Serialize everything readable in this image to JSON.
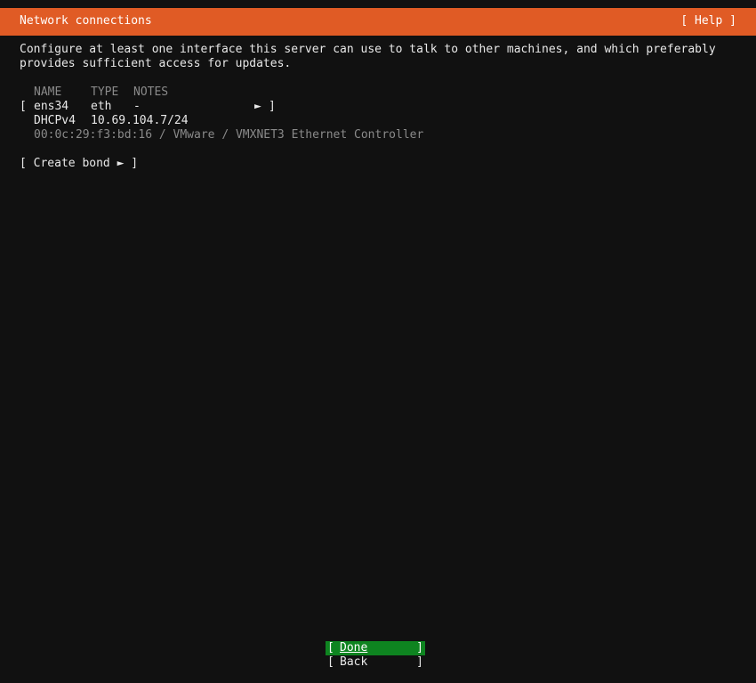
{
  "header": {
    "title": "Network connections",
    "help_label": "[ Help ]"
  },
  "intro": {
    "line1": "Configure at least one interface this server can use to talk to other machines, and which preferably",
    "line2": "provides sufficient access for updates."
  },
  "table": {
    "columns": [
      "NAME",
      "TYPE",
      "NOTES"
    ],
    "rows": [
      {
        "open_bracket": "[",
        "name": "ens34",
        "type": "eth",
        "notes": "-",
        "arrow": "►",
        "close_bracket": "]",
        "address_method": "DHCPv4",
        "address": "10.69.104.7/24",
        "hardware": "00:0c:29:f3:bd:16 / VMware / VMXNET3 Ethernet Controller"
      }
    ]
  },
  "create_bond_label": "[ Create bond ► ]",
  "buttons": {
    "done_open": "[",
    "done_label": "Done",
    "done_close": "]",
    "back_open": "[",
    "back_label": "Back",
    "back_close": "]"
  },
  "colors": {
    "header_bg": "#e05b25",
    "page_bg": "#111111",
    "focus_button_bg": "#0e8420",
    "muted_text": "#8a8a8a"
  }
}
